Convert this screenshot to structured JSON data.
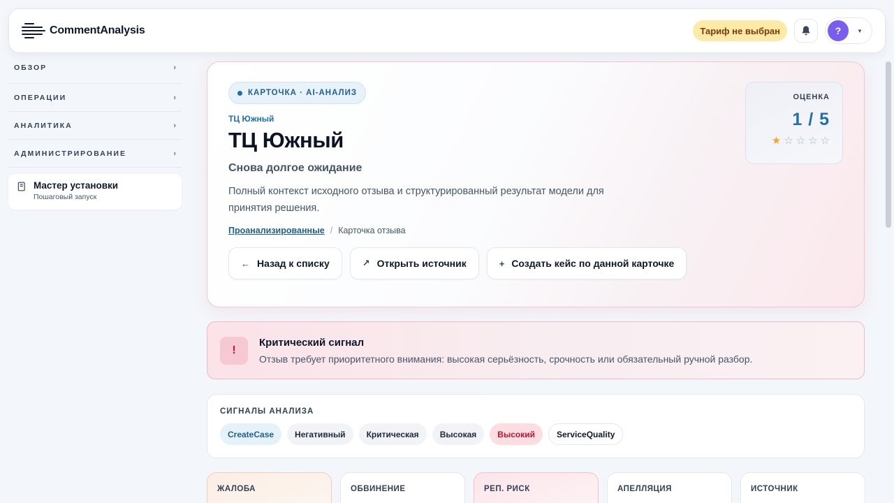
{
  "header": {
    "brand": "CommentAnalysis",
    "plan_badge": "Тариф не выбран",
    "avatar_initial": "?"
  },
  "sidebar": {
    "groups": [
      {
        "label": "ОБЗОР"
      },
      {
        "label": "ОПЕРАЦИИ"
      },
      {
        "label": "АНАЛИТИКА"
      },
      {
        "label": "АДМИНИСТРИРОВАНИЕ"
      }
    ],
    "setup": {
      "title": "Мастер установки",
      "subtitle": "Пошаговый запуск"
    }
  },
  "hero": {
    "tag": "КАРТОЧКА · AI-АНАЛИЗ",
    "kicker": "ТЦ Южный",
    "title": "ТЦ Южный",
    "subtitle": "Снова долгое ожидание",
    "description": "Полный контекст исходного отзыва и структурированный результат модели для принятия решения.",
    "breadcrumb": {
      "parent": "Проанализированные",
      "separator": "/",
      "current": "Карточка отзыва"
    },
    "actions": {
      "back": "Назад к списку",
      "open_source": "Открыть источник",
      "create_case": "Создать кейс по данной карточке"
    },
    "score": {
      "label": "ОЦЕНКА",
      "value": "1 / 5",
      "rating": 1,
      "max": 5
    }
  },
  "alert": {
    "icon": "!",
    "title": "Критический сигнал",
    "text": "Отзыв требует приоритетного внимания: высокая серьёзность, срочность или обязательный ручной разбор."
  },
  "signals": {
    "title": "СИГНАЛЫ АНАЛИЗА",
    "chips": [
      "CreateCase",
      "Негативный",
      "Критическая",
      "Высокая",
      "Высокий",
      "ServiceQuality"
    ]
  },
  "metrics": {
    "labels": [
      "ЖАЛОБА",
      "ОБВИНЕНИЕ",
      "РЕП. РИСК",
      "АПЕЛЛЯЦИЯ",
      "ИСТОЧНИК"
    ]
  },
  "colors": {
    "accent": "#1f6fb0",
    "critical": "#c0142f",
    "plan_badge_bg": "#fde9a8",
    "avatar_bg": "#7b5cf0",
    "star": "#f5a623"
  }
}
